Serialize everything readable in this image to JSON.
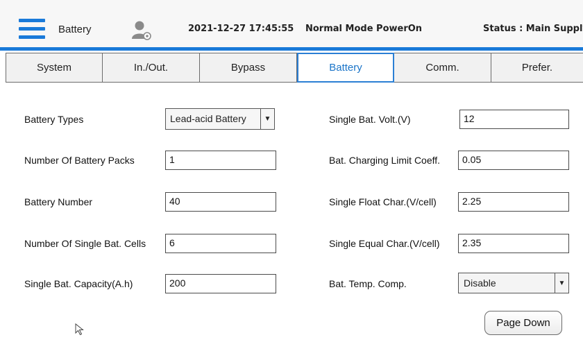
{
  "header": {
    "page_name": "Battery",
    "datetime": "2021-12-27 17:45:55",
    "mode": "Normal Mode  PowerOn",
    "status": "Status : Main Supply"
  },
  "tabs": [
    {
      "label": "System",
      "active": false
    },
    {
      "label": "In./Out.",
      "active": false
    },
    {
      "label": "Bypass",
      "active": false
    },
    {
      "label": "Battery",
      "active": true
    },
    {
      "label": "Comm.",
      "active": false
    },
    {
      "label": "Prefer.",
      "active": false
    }
  ],
  "left": {
    "battery_types_label": "Battery Types",
    "battery_types_value": "Lead-acid Battery",
    "packs_label": "Number Of Battery Packs",
    "packs_value": "1",
    "battery_number_label": "Battery Number",
    "battery_number_value": "40",
    "cells_label": "Number Of Single Bat. Cells",
    "cells_value": "6",
    "capacity_label": "Single Bat. Capacity(A.h)",
    "capacity_value": "200"
  },
  "right": {
    "volt_label": "Single Bat. Volt.(V)",
    "volt_value": "12",
    "coeff_label": "Bat. Charging Limit Coeff.",
    "coeff_value": "0.05",
    "float_label": "Single Float Char.(V/cell)",
    "float_value": "2.25",
    "equal_label": "Single Equal Char.(V/cell)",
    "equal_value": "2.35",
    "temp_label": "Bat. Temp. Comp.",
    "temp_value": "Disable"
  },
  "footer": {
    "page_down_label": "Page Down"
  },
  "colors": {
    "accent": "#1a7ad9",
    "active_tab_text": "#1a74c8"
  }
}
